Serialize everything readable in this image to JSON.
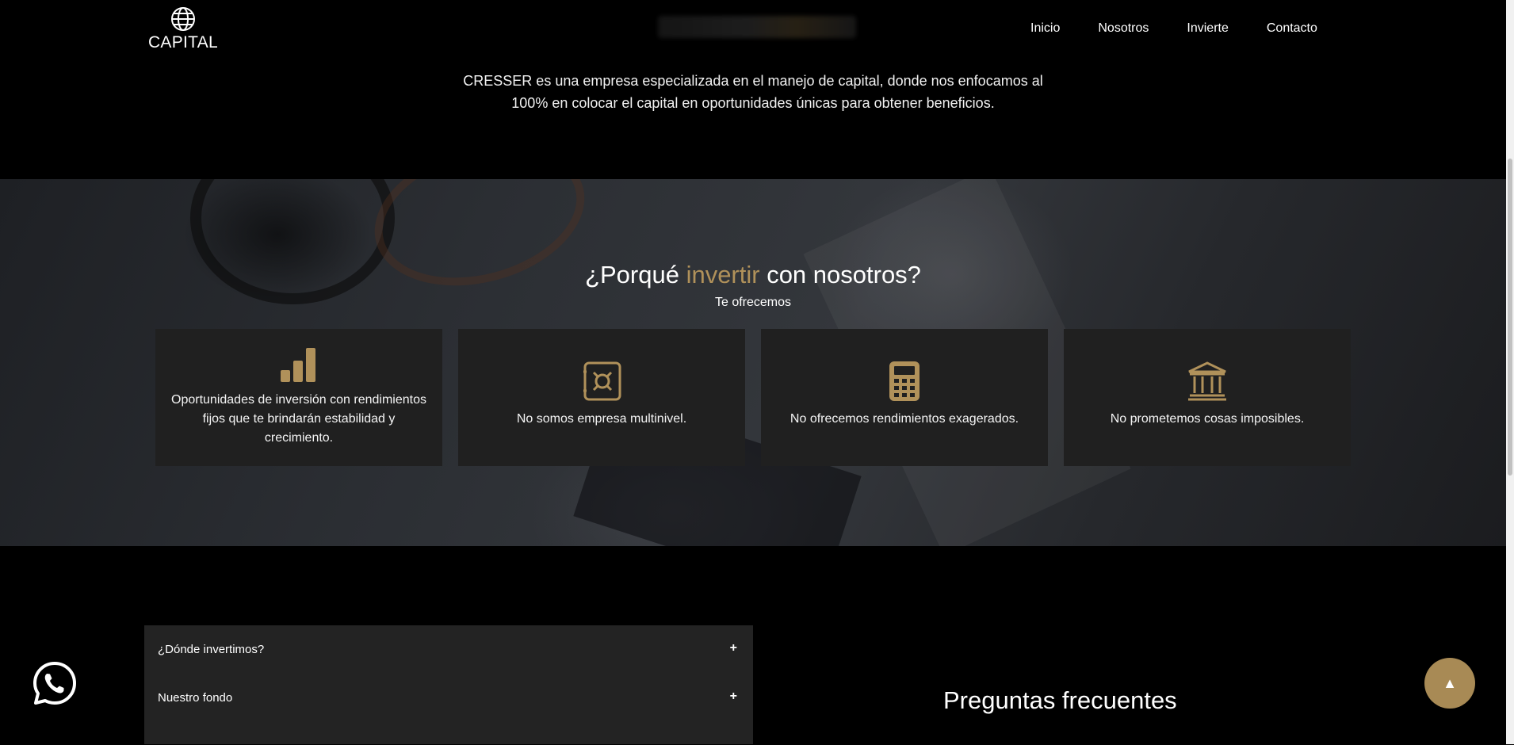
{
  "brand": {
    "name": "CAPITAL",
    "icon": "globe-icon"
  },
  "nav": {
    "items": [
      "Inicio",
      "Nosotros",
      "Invierte",
      "Contacto"
    ]
  },
  "intro": {
    "text": "CRESSER es una empresa especializada en el manejo de capital, donde nos enfocamos al 100% en colocar el capital en oportunidades únicas para obtener beneficios."
  },
  "why": {
    "title_pre": "¿Porqué ",
    "title_accent": "invertir",
    "title_post": " con nosotros?",
    "subtitle": "Te ofrecemos",
    "cards": [
      {
        "icon": "bar-chart-icon",
        "text": "Oportunidades de inversión con rendimientos fijos que te brindarán estabilidad y crecimiento."
      },
      {
        "icon": "safe-icon",
        "text": "No somos empresa multinivel."
      },
      {
        "icon": "calculator-icon",
        "text": "No ofrecemos rendimientos exagerados."
      },
      {
        "icon": "bank-icon",
        "text": "No prometemos cosas imposibles."
      }
    ]
  },
  "faq": {
    "title": "Preguntas frecuentes",
    "items": [
      {
        "label": "¿Dónde invertimos?",
        "toggle": "+"
      },
      {
        "label": "Nuestro fondo",
        "toggle": "+"
      }
    ]
  },
  "floating": {
    "whatsapp": "whatsapp-icon",
    "back_to_top": "▲"
  },
  "colors": {
    "accent": "#b0915a",
    "card_bg": "#202020",
    "faq_bg": "#232323",
    "back_to_top_bg": "#a88a55"
  }
}
